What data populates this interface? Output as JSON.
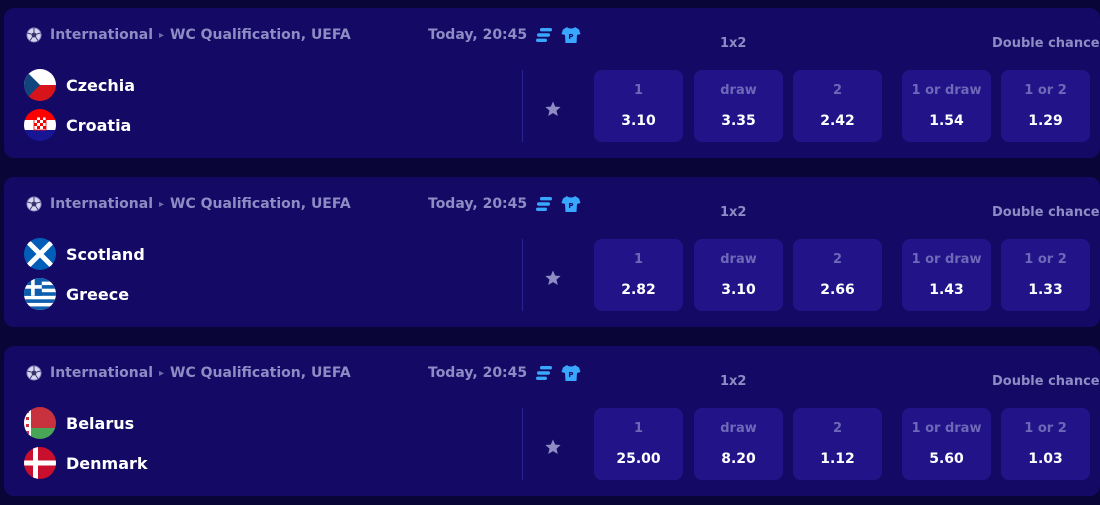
{
  "colors": {
    "page_background": "#0a0537",
    "card_background": "#140a66",
    "odd_button_background": "#221488",
    "accent_icon": "#3aa7ff",
    "muted_text": "#8f8bc4"
  },
  "market_titles": {
    "x12": "1x2",
    "double_chance": "Double chance"
  },
  "icons": {
    "sport": "football-icon",
    "stats": "stats-icon",
    "lineup": "shirt-icon",
    "favorite": "star-icon"
  },
  "matches": [
    {
      "category": "International",
      "tournament": "WC Qualification, UEFA",
      "time": "Today, 20:45",
      "home": {
        "name": "Czechia",
        "flag": "czechia-flag"
      },
      "away": {
        "name": "Croatia",
        "flag": "croatia-flag"
      },
      "odds": [
        {
          "label": "1",
          "value": "3.10"
        },
        {
          "label": "draw",
          "value": "3.35"
        },
        {
          "label": "2",
          "value": "2.42"
        },
        {
          "label": "1 or draw",
          "value": "1.54"
        },
        {
          "label": "1 or 2",
          "value": "1.29"
        }
      ]
    },
    {
      "category": "International",
      "tournament": "WC Qualification, UEFA",
      "time": "Today, 20:45",
      "home": {
        "name": "Scotland",
        "flag": "scotland-flag"
      },
      "away": {
        "name": "Greece",
        "flag": "greece-flag"
      },
      "odds": [
        {
          "label": "1",
          "value": "2.82"
        },
        {
          "label": "draw",
          "value": "3.10"
        },
        {
          "label": "2",
          "value": "2.66"
        },
        {
          "label": "1 or draw",
          "value": "1.43"
        },
        {
          "label": "1 or 2",
          "value": "1.33"
        }
      ]
    },
    {
      "category": "International",
      "tournament": "WC Qualification, UEFA",
      "time": "Today, 20:45",
      "home": {
        "name": "Belarus",
        "flag": "belarus-flag"
      },
      "away": {
        "name": "Denmark",
        "flag": "denmark-flag"
      },
      "odds": [
        {
          "label": "1",
          "value": "25.00"
        },
        {
          "label": "draw",
          "value": "8.20"
        },
        {
          "label": "2",
          "value": "1.12"
        },
        {
          "label": "1 or draw",
          "value": "5.60"
        },
        {
          "label": "1 or 2",
          "value": "1.03"
        }
      ]
    }
  ]
}
